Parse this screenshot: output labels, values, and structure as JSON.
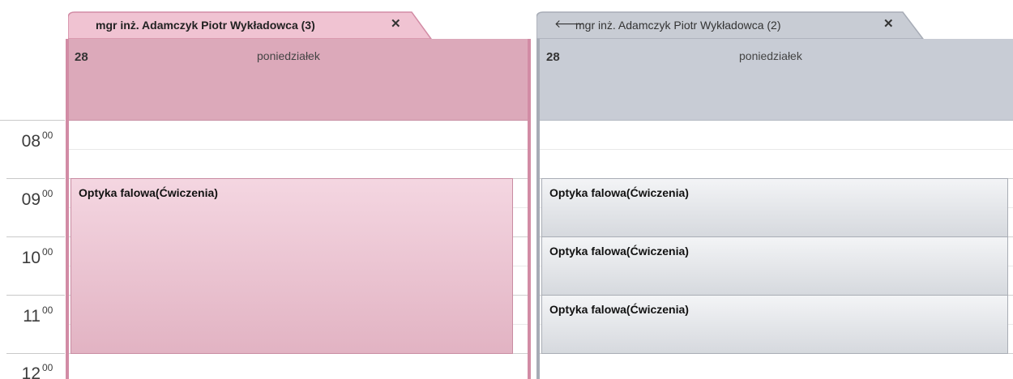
{
  "times": [
    {
      "hour": "08",
      "min": "00"
    },
    {
      "hour": "09",
      "min": "00"
    },
    {
      "hour": "10",
      "min": "00"
    },
    {
      "hour": "11",
      "min": "00"
    },
    {
      "hour": "12",
      "min": "00"
    }
  ],
  "calendars": [
    {
      "tab_title": "mgr inż. Adamczyk Piotr Wykładowca (3)",
      "close_symbol": "✕",
      "day_number": "28",
      "day_name": "poniedziałek",
      "color": "#dca9ba",
      "events": [
        {
          "title": "Optyka falowa(Ćwiczenia)",
          "start": "09:00",
          "end": "12:00"
        }
      ]
    },
    {
      "tab_title": "mgr inż. Adamczyk Piotr Wykładowca (2)",
      "arrow_symbol": "🡐",
      "close_symbol": "✕",
      "day_number": "28",
      "day_name": "poniedziałek",
      "color": "#c8ccd5",
      "events": [
        {
          "title": "Optyka falowa(Ćwiczenia)",
          "start": "09:00",
          "end": "10:00"
        },
        {
          "title": "Optyka falowa(Ćwiczenia)",
          "start": "10:00",
          "end": "11:00"
        },
        {
          "title": "Optyka falowa(Ćwiczenia)",
          "start": "11:00",
          "end": "12:00"
        }
      ]
    }
  ]
}
